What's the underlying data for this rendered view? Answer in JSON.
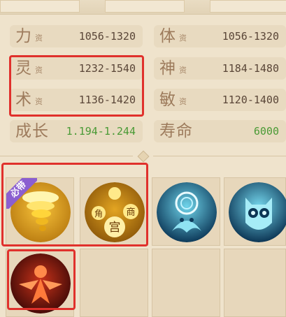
{
  "stats": [
    {
      "name": "力",
      "sub": "资",
      "value": "1056-1320"
    },
    {
      "name": "体",
      "sub": "资",
      "value": "1056-1320"
    },
    {
      "name": "灵",
      "sub": "资",
      "value": "1232-1540"
    },
    {
      "name": "神",
      "sub": "资",
      "value": "1184-1480"
    },
    {
      "name": "术",
      "sub": "资",
      "value": "1136-1420"
    },
    {
      "name": "敏",
      "sub": "资",
      "value": "1120-1400"
    }
  ],
  "growth": {
    "label": "成长",
    "value": "1.194-1.244"
  },
  "life": {
    "label": "寿命",
    "value": "6000"
  },
  "skills": [
    {
      "icon": "golden-tornado-icon",
      "badge": "必带"
    },
    {
      "icon": "golden-coins-palace-icon",
      "coin_labels": [
        "角",
        "宫",
        "商"
      ]
    },
    {
      "icon": "blue-ghost-vortex-icon"
    },
    {
      "icon": "blue-owl-spirit-icon"
    },
    {
      "icon": "red-fire-spirit-icon"
    }
  ],
  "colors": {
    "highlight": "#e0312c",
    "green_value": "#4a9a35"
  }
}
